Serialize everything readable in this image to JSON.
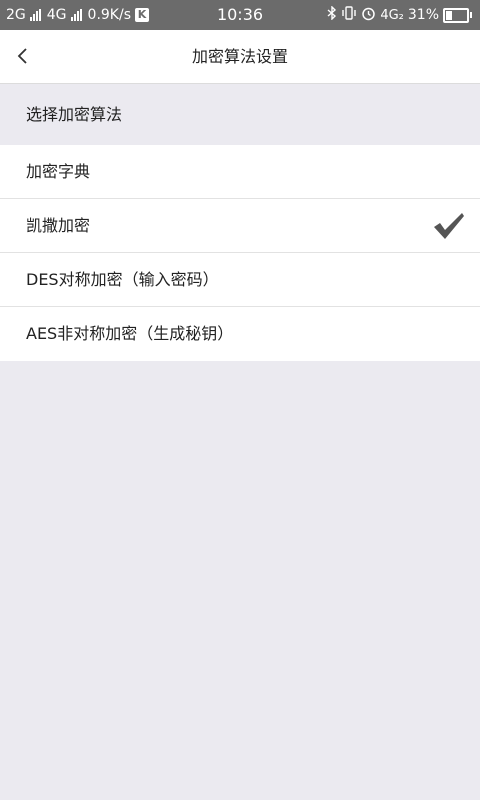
{
  "status_bar": {
    "net1": "2G",
    "net2": "4G",
    "speed": "0.9K/s",
    "app_badge": "K",
    "time": "10:36",
    "lte": "4G₂",
    "battery_percent": "31%",
    "battery_level": 0.31
  },
  "navbar": {
    "title": "加密算法设置"
  },
  "section": {
    "header": "选择加密算法"
  },
  "options": [
    {
      "label": "加密字典",
      "selected": false
    },
    {
      "label": "凯撒加密",
      "selected": true
    },
    {
      "label": "DES对称加密（输入密码）",
      "selected": false
    },
    {
      "label": "AES非对称加密（生成秘钥）",
      "selected": false
    }
  ],
  "colors": {
    "status_bar": "#6b6b6b",
    "background": "#ebeaf0",
    "check": "#555555"
  }
}
